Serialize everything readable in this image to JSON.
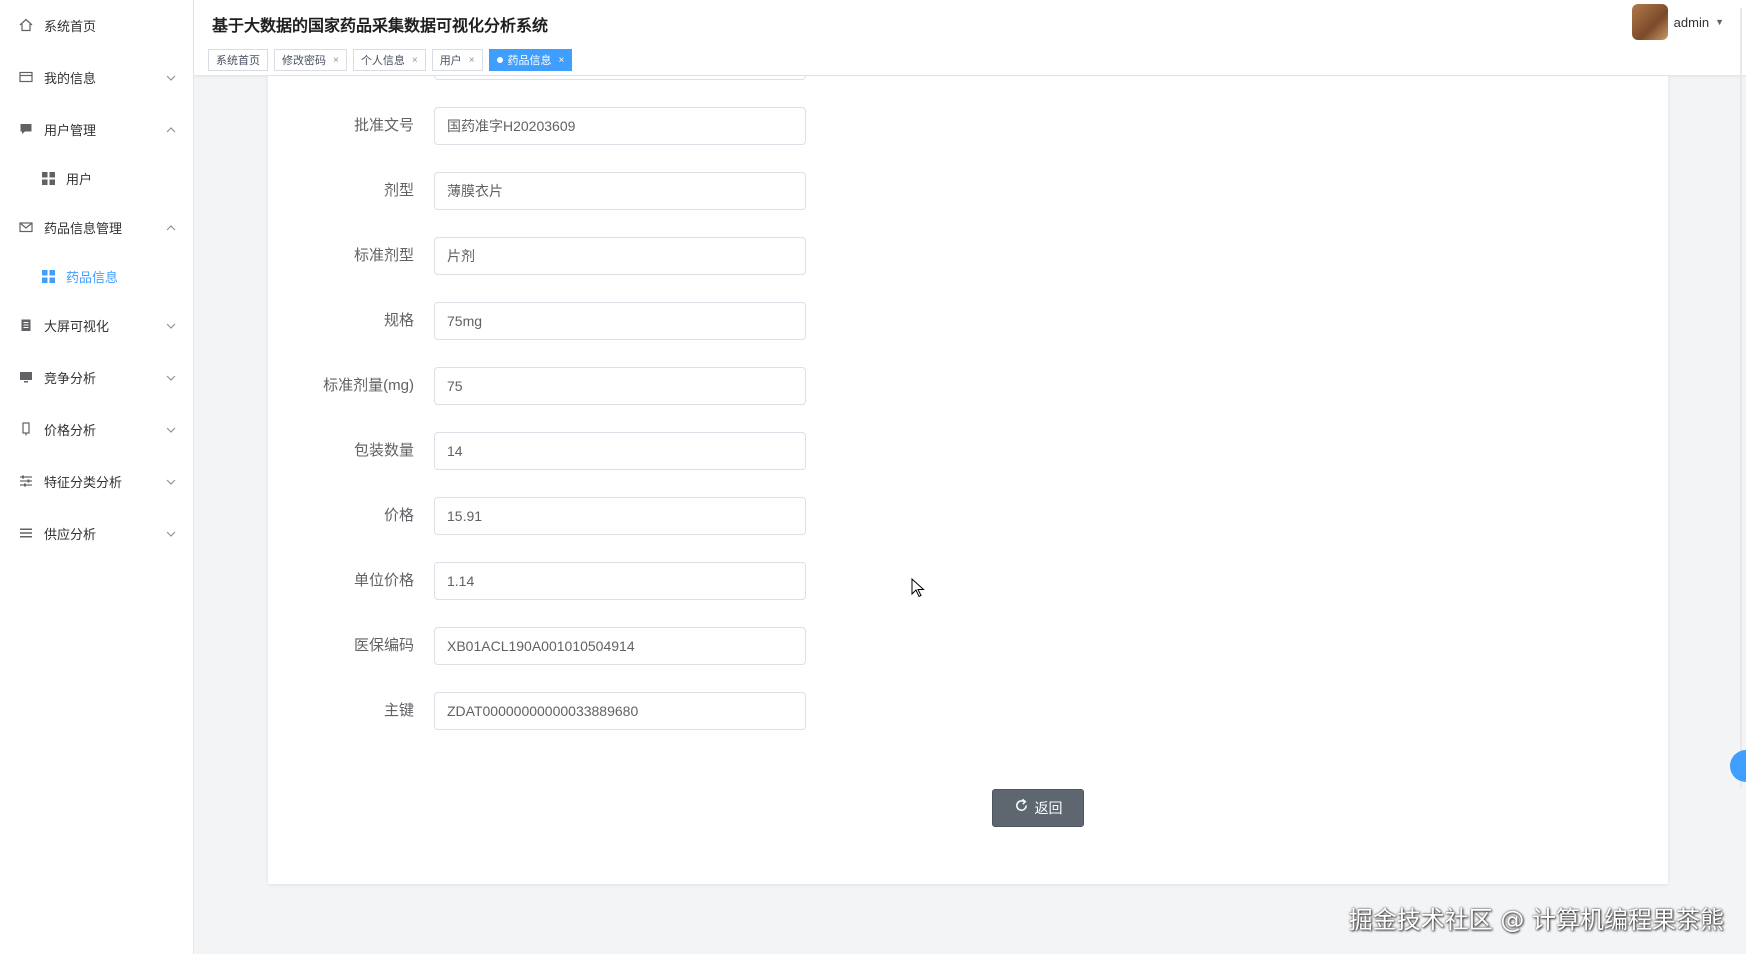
{
  "app": {
    "title": "基于大数据的国家药品采集数据可视化分析系统"
  },
  "user": {
    "name": "admin"
  },
  "sidebar": {
    "items": [
      {
        "label": "系统首页",
        "icon": "home-icon"
      },
      {
        "label": "我的信息",
        "icon": "id-card-icon"
      },
      {
        "label": "用户管理",
        "icon": "chat-icon"
      },
      {
        "label": "用户",
        "icon": "grid-icon"
      },
      {
        "label": "药品信息管理",
        "icon": "mail-icon"
      },
      {
        "label": "药品信息",
        "icon": "grid-icon"
      },
      {
        "label": "大屏可视化",
        "icon": "clipboard-icon"
      },
      {
        "label": "竞争分析",
        "icon": "monitor-icon"
      },
      {
        "label": "价格分析",
        "icon": "tag-icon"
      },
      {
        "label": "特征分类分析",
        "icon": "sliders-icon"
      },
      {
        "label": "供应分析",
        "icon": "list-icon"
      }
    ]
  },
  "tabs": [
    {
      "label": "系统首页"
    },
    {
      "label": "修改密码"
    },
    {
      "label": "个人信息"
    },
    {
      "label": "用户"
    },
    {
      "label": "药品信息"
    }
  ],
  "form": {
    "fields": [
      {
        "label": "批准文号",
        "value": "国药准字H20203609"
      },
      {
        "label": "剂型",
        "value": "薄膜衣片"
      },
      {
        "label": "标准剂型",
        "value": "片剂"
      },
      {
        "label": "规格",
        "value": "75mg"
      },
      {
        "label": "标准剂量(mg)",
        "value": "75"
      },
      {
        "label": "包装数量",
        "value": "14"
      },
      {
        "label": "价格",
        "value": "15.91"
      },
      {
        "label": "单位价格",
        "value": "1.14"
      },
      {
        "label": "医保编码",
        "value": "XB01ACL190A001010504914"
      },
      {
        "label": "主键",
        "value": "ZDAT00000000000033889680"
      }
    ],
    "back_label": "返回"
  },
  "watermark": "掘金技术社区 @ 计算机编程果茶熊",
  "colors": {
    "accent": "#409eff",
    "button_dark": "#5e6670"
  }
}
